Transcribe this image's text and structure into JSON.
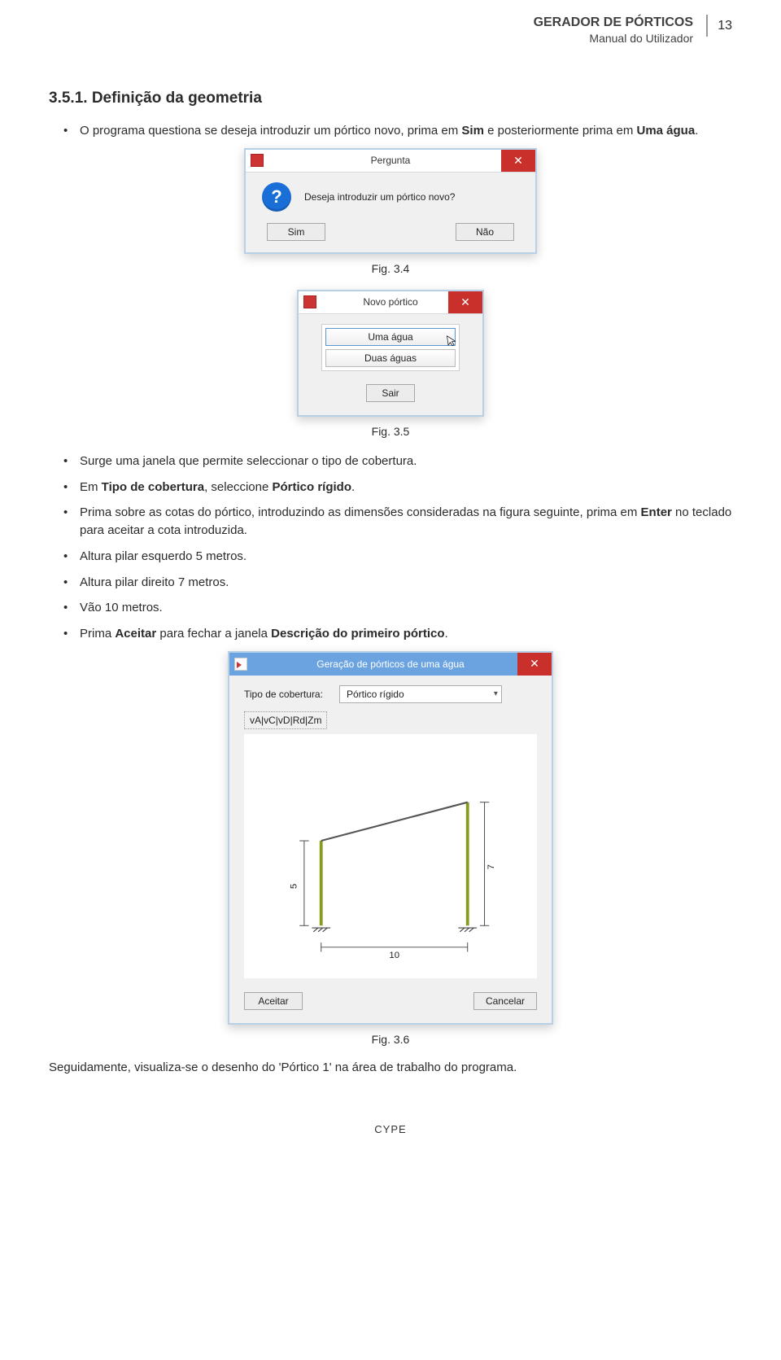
{
  "header": {
    "title": "GERADOR DE PÓRTICOS",
    "subtitle": "Manual do Utilizador",
    "page_number": "13"
  },
  "section": {
    "number": "3.5.1.",
    "title": "Definição da geometria"
  },
  "para1_prefix": "O programa questiona se deseja introduzir um pórtico novo, prima em ",
  "para1_b1": "Sim",
  "para1_mid": " e posteriormente prima em ",
  "para1_b2": "Uma água",
  "para1_suffix": ".",
  "dlg_pergunta": {
    "title": "Pergunta",
    "question": "Deseja introduzir um pórtico novo?",
    "yes": "Sim",
    "no": "Não"
  },
  "cap_3_4": "Fig. 3.4",
  "dlg_novo": {
    "title": "Novo pórtico",
    "opt1": "Uma água",
    "opt2": "Duas águas",
    "exit": "Sair"
  },
  "cap_3_5": "Fig. 3.5",
  "bullets2": {
    "i0": "Surge uma janela que permite seleccionar o tipo de cobertura.",
    "i1_pre": "Em ",
    "i1_b1": "Tipo de cobertura",
    "i1_mid": ", seleccione ",
    "i1_b2": "Pórtico rígido",
    "i1_suf": ".",
    "i2_pre": "Prima sobre as cotas do pórtico, introduzindo as dimensões consideradas na figura seguinte, prima em ",
    "i2_b": "Enter",
    "i2_suf": " no teclado para aceitar a cota introduzida.",
    "i3": "Altura pilar esquerdo 5 metros.",
    "i4": "Altura pilar direito 7 metros.",
    "i5": "Vão 10 metros.",
    "i6_pre": "Prima ",
    "i6_b1": "Aceitar",
    "i6_mid": " para fechar a janela ",
    "i6_b2": "Descrição do primeiro pórtico",
    "i6_suf": "."
  },
  "dlg_gera": {
    "title": "Geração de pórticos de uma água",
    "field_label": "Tipo de cobertura:",
    "select_value": "Pórtico rígido",
    "toolbar_codes": "vA|vC|vD|Rd|Zm",
    "accept": "Aceitar",
    "cancel": "Cancelar"
  },
  "chart_data": {
    "type": "diagram",
    "left_pillar_height": 5,
    "right_pillar_height": 7,
    "span": 10
  },
  "cap_3_6": "Fig. 3.6",
  "closing": "Seguidamente, visualiza-se o desenho do 'Pórtico 1' na área de trabalho do programa.",
  "footer": "CYPE"
}
